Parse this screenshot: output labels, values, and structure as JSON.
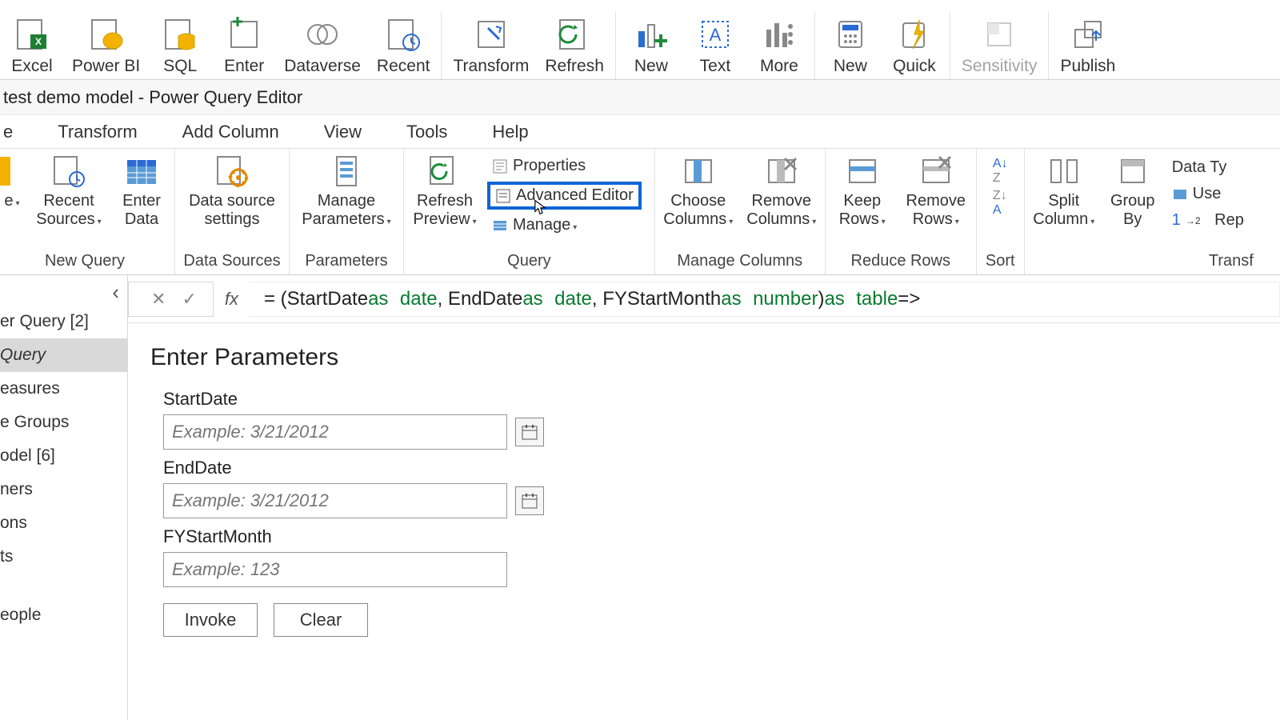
{
  "topRibbon": {
    "items": [
      {
        "label": "Excel",
        "name": "excel-button"
      },
      {
        "label": "Power BI",
        "name": "powerbi-button"
      },
      {
        "label": "SQL",
        "name": "sql-button"
      },
      {
        "label": "Enter",
        "name": "enter-data-button"
      },
      {
        "label": "Dataverse",
        "name": "dataverse-button"
      },
      {
        "label": "Recent",
        "name": "recent-sources-button"
      },
      {
        "label": "Transform",
        "name": "transform-data-button"
      },
      {
        "label": "Refresh",
        "name": "refresh-button"
      },
      {
        "label": "New",
        "name": "new-visual-button"
      },
      {
        "label": "Text",
        "name": "text-box-button"
      },
      {
        "label": "More",
        "name": "more-visuals-button"
      },
      {
        "label": "New",
        "name": "new-measure-button"
      },
      {
        "label": "Quick",
        "name": "quick-measure-button"
      },
      {
        "label": "Sensitivity",
        "name": "sensitivity-button",
        "dim": true
      },
      {
        "label": "Publish",
        "name": "publish-button"
      }
    ]
  },
  "title": "test demo model - Power Query Editor",
  "menu": [
    "Transform",
    "Add Column",
    "View",
    "Tools",
    "Help"
  ],
  "homeRibbon": {
    "groups": {
      "newQuery": {
        "cap": "New Query",
        "recent": "Recent\nSources",
        "enter": "Enter\nData"
      },
      "dataSources": {
        "cap": "Data Sources",
        "btn": "Data source\nsettings"
      },
      "parameters": {
        "cap": "Parameters",
        "btn": "Manage\nParameters"
      },
      "query": {
        "cap": "Query",
        "refresh": "Refresh\nPreview",
        "properties": "Properties",
        "advanced": "Advanced Editor",
        "manage": "Manage"
      },
      "manageColumns": {
        "cap": "Manage Columns",
        "choose": "Choose\nColumns",
        "remove": "Remove\nColumns"
      },
      "reduceRows": {
        "cap": "Reduce Rows",
        "keep": "Keep\nRows",
        "remove": "Remove\nRows"
      },
      "sort": {
        "cap": "Sort"
      },
      "transform": {
        "cap": "Transf",
        "split": "Split\nColumn",
        "group": "Group\nBy",
        "dt": "Data Ty",
        "use": "Use",
        "rep": "Rep"
      }
    }
  },
  "formula": {
    "prefix": "= (StartDate ",
    "as": "as",
    "date": "date",
    "number": "number",
    "table": "table",
    "p1": ", EndDate ",
    "p2": ", FYStartMonth ",
    "p3": ") ",
    "p4": " =>"
  },
  "sidebar": {
    "header": "er Query [2]",
    "items": [
      "Query",
      "easures",
      "e Groups",
      "odel [6]",
      "ners",
      "ons",
      "ts",
      "eople"
    ]
  },
  "params": {
    "title": "Enter Parameters",
    "fields": [
      {
        "label": "StartDate",
        "placeholder": "Example: 3/21/2012",
        "date": true
      },
      {
        "label": "EndDate",
        "placeholder": "Example: 3/21/2012",
        "date": true
      },
      {
        "label": "FYStartMonth",
        "placeholder": "Example: 123",
        "date": false
      }
    ],
    "invoke": "Invoke",
    "clear": "Clear"
  }
}
